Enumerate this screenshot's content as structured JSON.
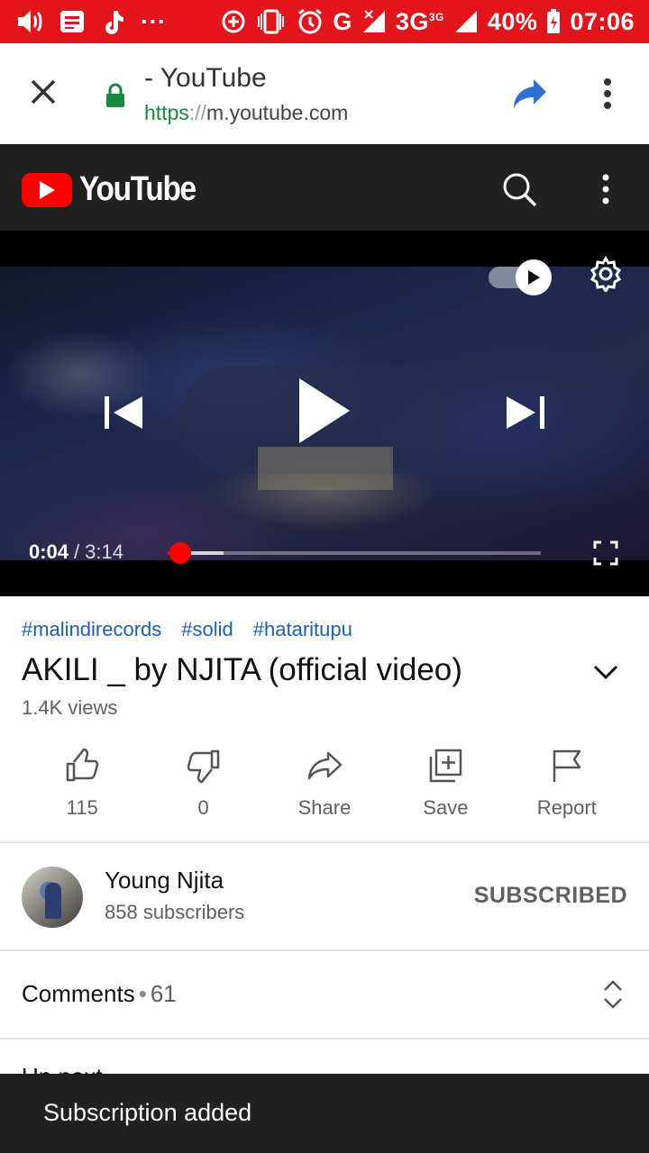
{
  "status_bar": {
    "dots": "···",
    "network_g": "G",
    "network_3g": "3G",
    "network_3g_sup": "3G",
    "battery": "40%",
    "time": "07:06"
  },
  "browser": {
    "title": "- YouTube",
    "url_scheme": "https",
    "url_sep": "://",
    "url_host": "m.youtube.com"
  },
  "youtube": {
    "logo_text": "YouTube"
  },
  "player": {
    "current_time": "0:04",
    "separator": "/",
    "duration": "3:14",
    "played_fraction": 0.02,
    "buffered_fraction": 0.15,
    "autoplay_on": true
  },
  "video": {
    "hashtags": [
      "#malindirecords",
      "#solid",
      "#hataritupu"
    ],
    "title": "AKILI _ by NJITA (official video)",
    "views": "1.4K views"
  },
  "actions": [
    {
      "icon": "thumbs-up-icon",
      "label": "115"
    },
    {
      "icon": "thumbs-down-icon",
      "label": "0"
    },
    {
      "icon": "share-icon",
      "label": "Share"
    },
    {
      "icon": "save-playlist-icon",
      "label": "Save"
    },
    {
      "icon": "flag-icon",
      "label": "Report"
    }
  ],
  "channel": {
    "name": "Young Njita",
    "subscribers": "858 subscribers",
    "subscribe_label": "SUBSCRIBED"
  },
  "comments": {
    "label": "Comments",
    "dot": "•",
    "count": "61"
  },
  "up_next": {
    "label": "Up next"
  },
  "snackbar": {
    "message": "Subscription added"
  },
  "colors": {
    "status_bar": "#e3141b",
    "youtube_red": "#ff0000",
    "header_bg": "#212121",
    "link_blue": "#1a5fb4",
    "secure_green": "#168a3a"
  }
}
